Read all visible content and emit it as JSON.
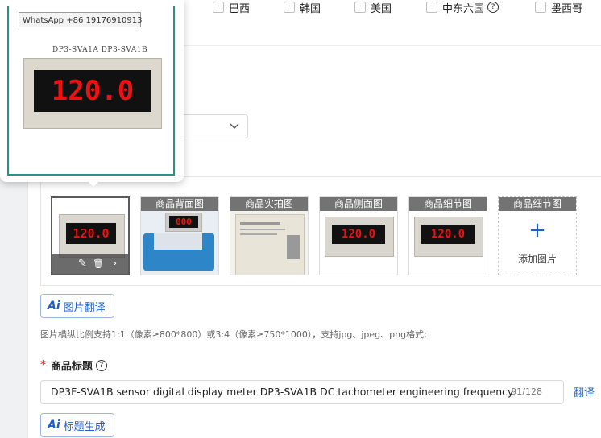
{
  "countries": [
    {
      "label": "巴西",
      "has_help": false
    },
    {
      "label": "韩国",
      "has_help": false
    },
    {
      "label": "美国",
      "has_help": false
    },
    {
      "label": "中东六国",
      "has_help": true
    },
    {
      "label": "墨西哥",
      "has_help": false
    }
  ],
  "help_glyph": "?",
  "preview": {
    "whatsapp": "WhatsApp +86 19176910913",
    "models": "DP3-SVA1A     DP3-SVA1B",
    "reading": "120.0"
  },
  "images": {
    "tiles": [
      {
        "caption": "",
        "reading": "120.0",
        "selected": true
      },
      {
        "caption": "商品背面图",
        "reading": "000"
      },
      {
        "caption": "商品实拍图"
      },
      {
        "caption": "商品侧面图",
        "reading": "120.0"
      },
      {
        "caption": "商品细节图",
        "reading": "120.0"
      }
    ],
    "add_caption": "商品细节图",
    "add_plus": "+",
    "add_label": "添加图片",
    "tool_icons": [
      "edit-icon",
      "trash-icon",
      "chevron-right-icon"
    ],
    "tool_glyphs": {
      "edit": "✎",
      "trash": "🗑",
      "next": "›"
    }
  },
  "translate_images_button": {
    "ai": "Ai",
    "label": "图片翻译"
  },
  "image_hint": "图片横纵比例支持1:1（像素≥800*800）或3:4（像素≥750*1000），支持jpg、jpeg、png格式;",
  "title_field": {
    "required_mark": "*",
    "label": "商品标题",
    "value": "DP3F-SVA1B sensor digital display meter DP3-SVA1B DC tachometer engineering frequency",
    "counter": "91/128",
    "translate_link": "翻译"
  },
  "generate_title_button": {
    "ai": "Ai",
    "label": "标题生成"
  },
  "colors": {
    "accent": "#1d5fd0",
    "required": "#e33333",
    "popup_border": "#2f8e86"
  }
}
